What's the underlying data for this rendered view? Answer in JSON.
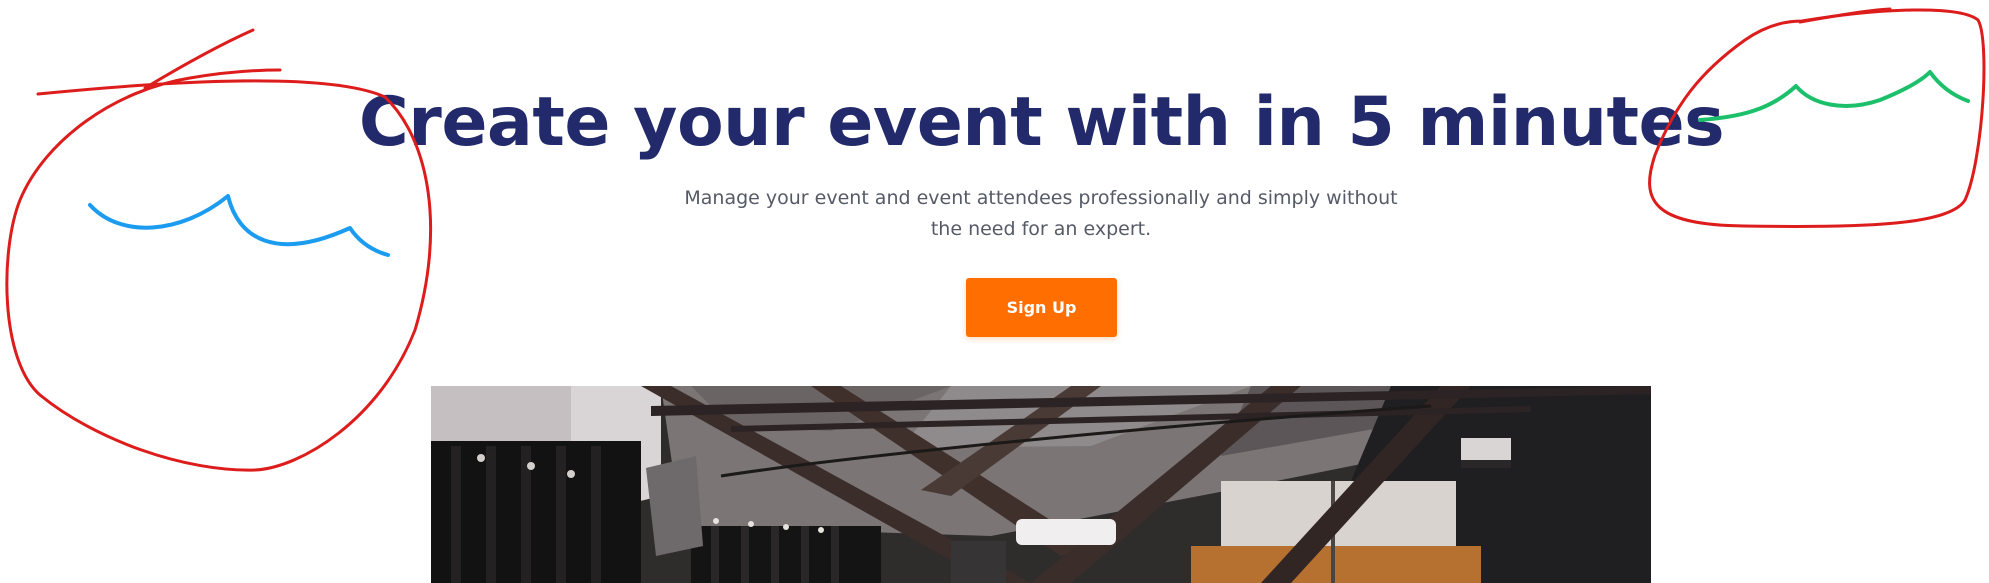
{
  "hero": {
    "title": "Create your event with in 5 minutes",
    "subtitle": "Manage your event and event attendees professionally and simply without the need for an expert.",
    "cta_label": "Sign Up"
  },
  "colors": {
    "title": "#222a6b",
    "subtitle": "#555a66",
    "cta_background": "#fe6e00",
    "cta_text": "#ffffff",
    "annotation_red": "#dd1c1c",
    "annotation_blue": "#1c9cf0",
    "annotation_green": "#1cc06a"
  },
  "image": {
    "subject": "event-venue-photo"
  }
}
